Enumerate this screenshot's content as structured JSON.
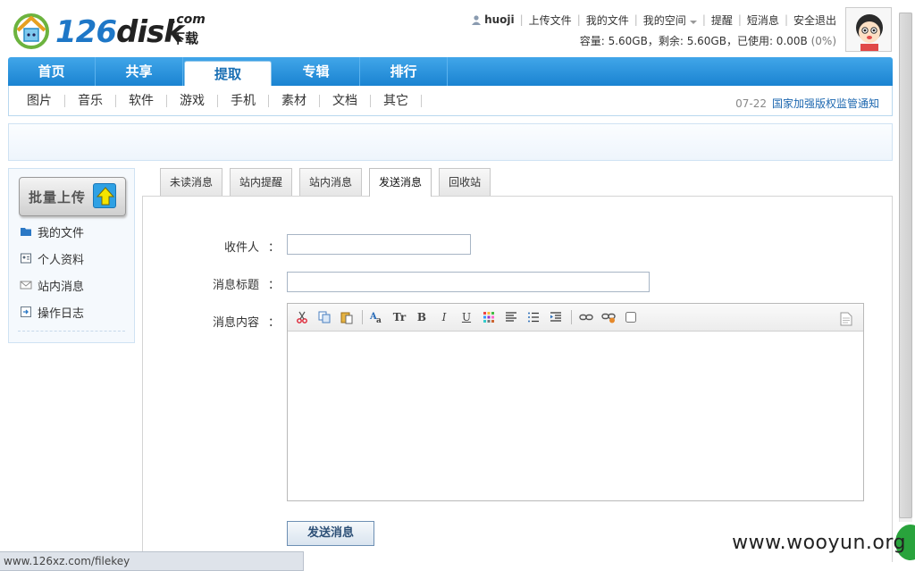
{
  "header": {
    "logo_num": "126",
    "logo_word": "disk",
    "logo_com": ".com",
    "logo_download": "下载",
    "username": "huoji",
    "links": [
      "上传文件",
      "我的文件",
      "我的空间",
      "提醒",
      "短消息",
      "安全退出"
    ],
    "quota": "容量: 5.60GB，剩余: 5.60GB，已使用: 0.00B",
    "quota_pct": "(0%)"
  },
  "main_nav": [
    "首页",
    "共享",
    "提取",
    "专辑",
    "排行"
  ],
  "sub_nav": [
    "图片",
    "音乐",
    "软件",
    "游戏",
    "手机",
    "素材",
    "文档",
    "其它"
  ],
  "notice": {
    "date": "07-22",
    "text": "国家加强版权监管通知"
  },
  "sidebar": {
    "upload_label": "批量上传",
    "items": [
      "我的文件",
      "个人资料",
      "站内消息",
      "操作日志"
    ]
  },
  "tabs": [
    "未读消息",
    "站内提醒",
    "站内消息",
    "发送消息",
    "回收站"
  ],
  "form": {
    "recipient_label": "收件人",
    "subject_label": "消息标题",
    "content_label": "消息内容",
    "colon": "：",
    "recipient_value": "",
    "subject_value": "",
    "send_label": "发送消息"
  },
  "toolbar_text": {
    "font_size": "Tr",
    "bold": "B",
    "italic": "I",
    "underline": "U"
  },
  "status_url": "www.126xz.com/filekey",
  "watermark": "www.wooyun.org",
  "colors": {
    "nav_blue": "#1a83d1",
    "link_blue": "#1e68b0",
    "accent_green": "#29a33c"
  }
}
